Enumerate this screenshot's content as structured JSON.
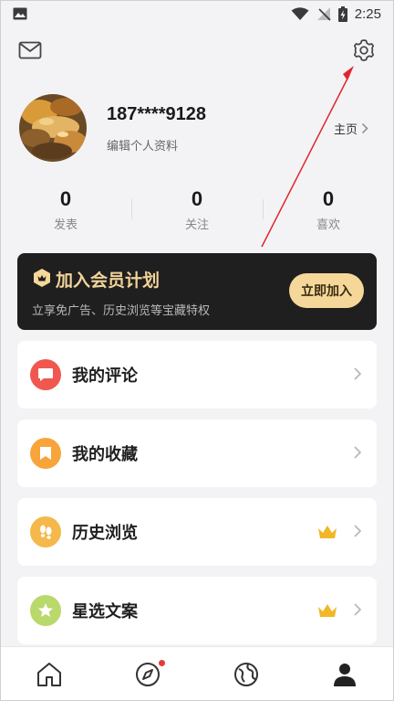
{
  "status_bar": {
    "time": "2:25",
    "icons": [
      "image-icon",
      "wifi-icon",
      "signal-off-icon",
      "battery-charging-icon"
    ]
  },
  "header": {
    "left_icon": "mail-icon",
    "right_icon": "gear-icon"
  },
  "profile": {
    "phone": "187****9128",
    "edit_label": "编辑个人资料",
    "homepage_label": "主页"
  },
  "stats": [
    {
      "value": "0",
      "label": "发表"
    },
    {
      "value": "0",
      "label": "关注"
    },
    {
      "value": "0",
      "label": "喜欢"
    }
  ],
  "vip": {
    "title": "加入会员计划",
    "description": "立享免广告、历史浏览等宝藏特权",
    "button_label": "立即加入",
    "accent_color": "#f5d79a",
    "background_color": "#1f1f1f"
  },
  "menu": [
    {
      "label": "我的评论",
      "icon": "comment-icon",
      "color": "#f0574f",
      "vip": false
    },
    {
      "label": "我的收藏",
      "icon": "bookmark-icon",
      "color": "#f7a53b",
      "vip": false
    },
    {
      "label": "历史浏览",
      "icon": "footprint-icon",
      "color": "#f5b84a",
      "vip": true
    },
    {
      "label": "星选文案",
      "icon": "star-icon",
      "color": "#b9d96a",
      "vip": true
    }
  ],
  "bottom_nav": [
    {
      "name": "home",
      "icon": "home-icon",
      "active": false,
      "badge": false
    },
    {
      "name": "discover",
      "icon": "compass-icon",
      "active": false,
      "badge": true
    },
    {
      "name": "explore",
      "icon": "globe-icon",
      "active": false,
      "badge": false
    },
    {
      "name": "profile",
      "icon": "user-icon",
      "active": true,
      "badge": false
    }
  ],
  "annotation": {
    "arrow_color": "#e0262b"
  }
}
